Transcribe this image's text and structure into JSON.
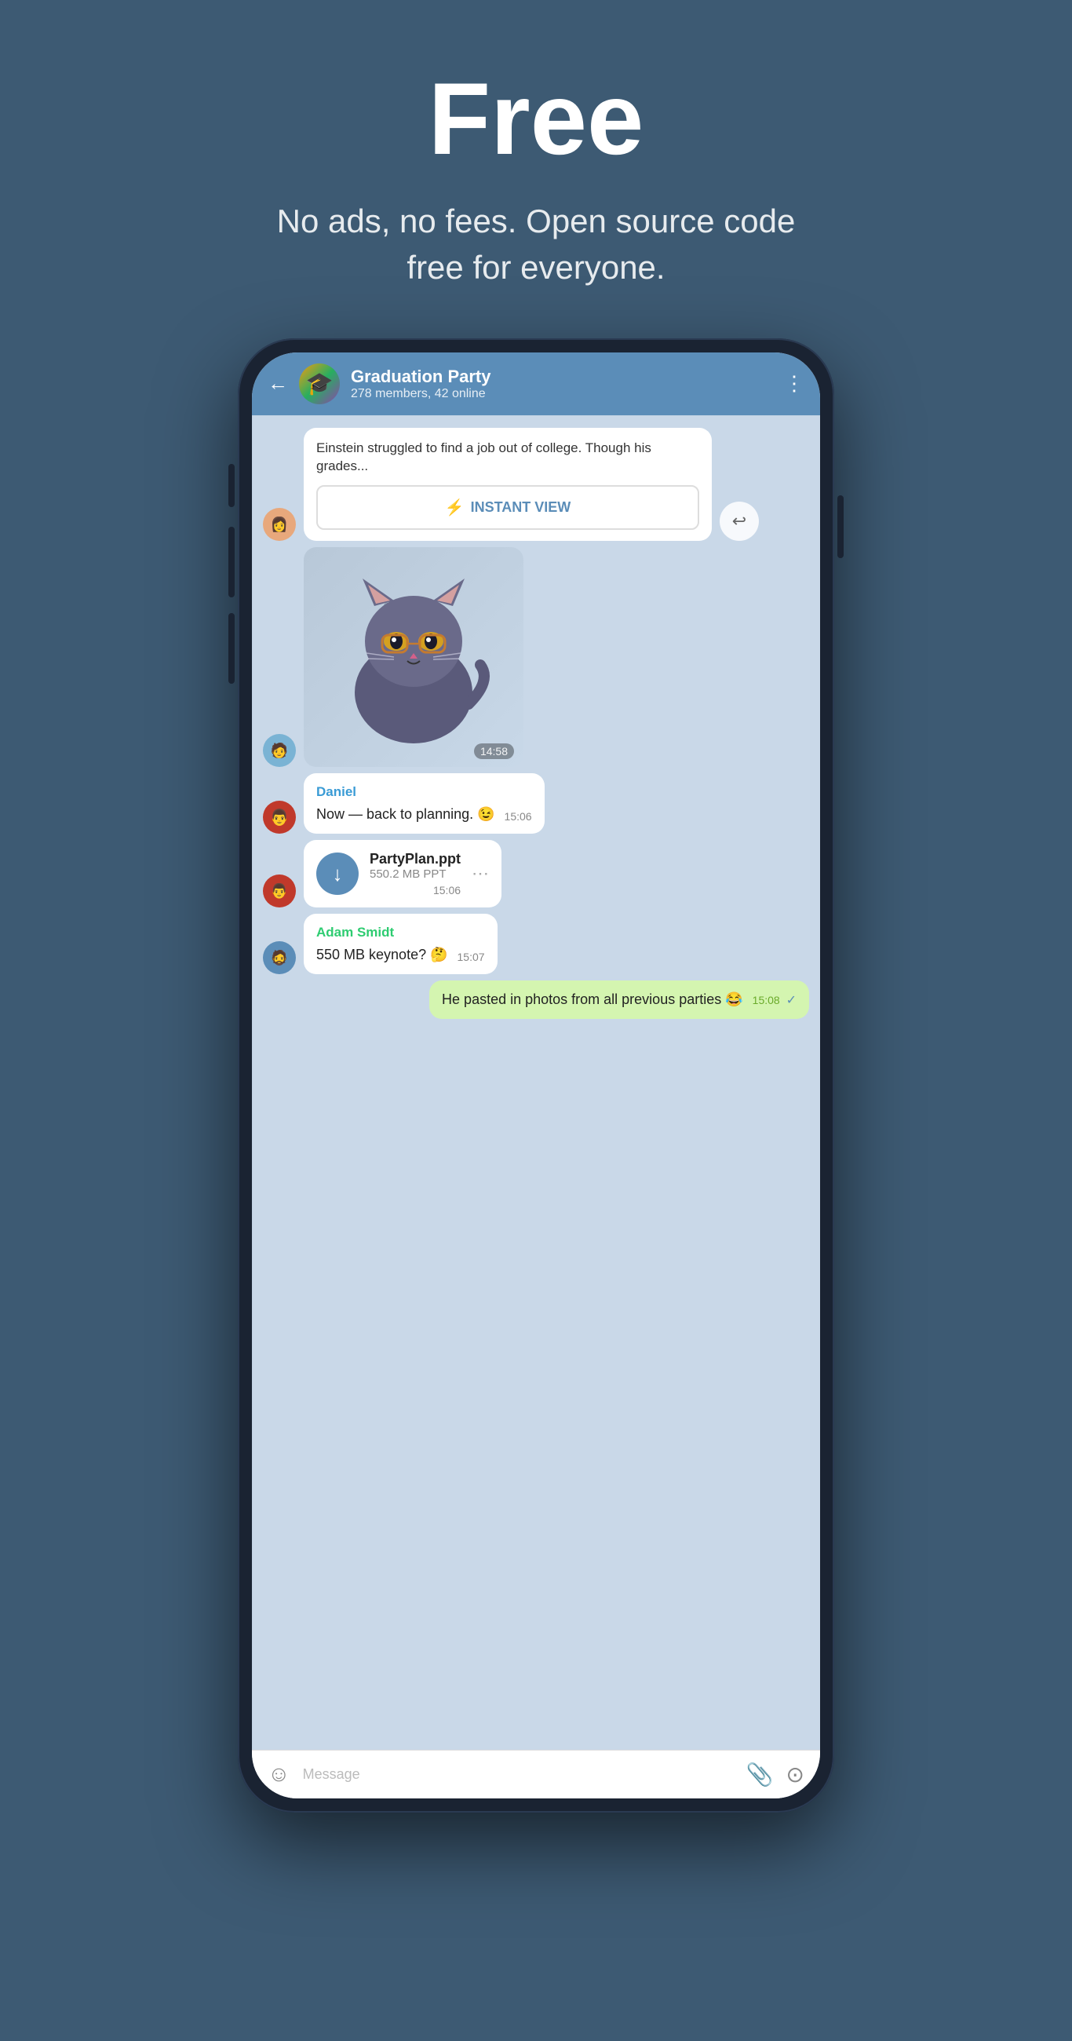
{
  "hero": {
    "title": "Free",
    "subtitle": "No ads, no fees. Open source code free for everyone."
  },
  "phone": {
    "header": {
      "group_name": "Graduation Party",
      "members_info": "278 members, 42 online",
      "back_label": "←",
      "menu_label": "⋮"
    },
    "messages": [
      {
        "id": "link-preview",
        "type": "link",
        "text": "Einstein struggled to find a job out of college. Though his grades...",
        "btn_label": "INSTANT VIEW",
        "avatar_emoji": "👩",
        "avatar_bg": "#e8a87c"
      },
      {
        "id": "sticker-msg",
        "type": "sticker",
        "time": "14:58",
        "avatar_emoji": "🧑",
        "avatar_bg": "#7ab3d4"
      },
      {
        "id": "daniel-msg",
        "type": "text",
        "sender": "Daniel",
        "sender_color": "daniel",
        "text": "Now — back to planning. 😉",
        "time": "15:06",
        "avatar_emoji": "👨",
        "avatar_bg": "#c0392b"
      },
      {
        "id": "file-msg",
        "type": "file",
        "file_name": "PartyPlan.ppt",
        "file_size": "550.2 MB PPT",
        "time": "15:06",
        "avatar_emoji": "👨",
        "avatar_bg": "#c0392b"
      },
      {
        "id": "adam-msg",
        "type": "text",
        "sender": "Adam Smidt",
        "sender_color": "adam",
        "text": "550 MB keynote? 🤔",
        "time": "15:07",
        "avatar_emoji": "🧔",
        "avatar_bg": "#5b8db8"
      },
      {
        "id": "own-msg",
        "type": "own",
        "text": "He pasted in photos from all previous parties 😂",
        "time": "15:08",
        "checkmark": "✓"
      }
    ],
    "input": {
      "placeholder": "Message",
      "emoji_icon": "☺",
      "attach_icon": "📎",
      "camera_icon": "◎"
    }
  }
}
